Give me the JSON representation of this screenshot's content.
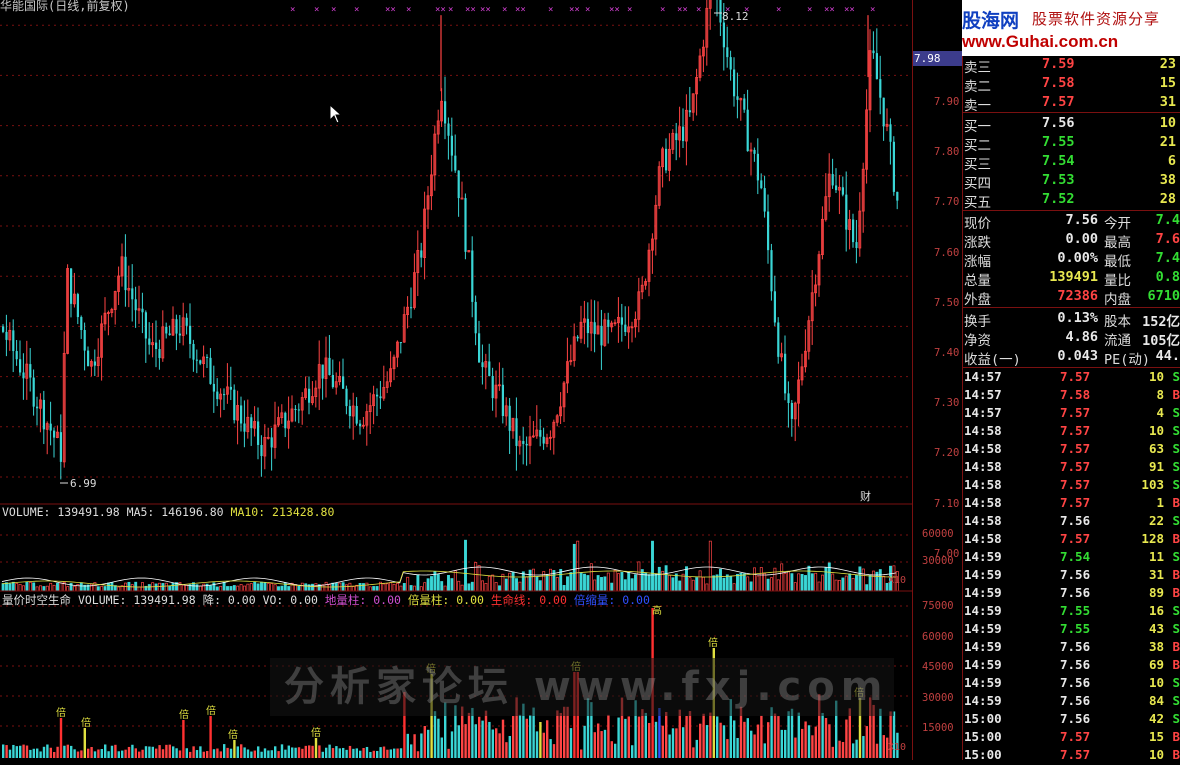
{
  "main": {
    "title": "华能国际(日线,前复权)",
    "high_label": "8.12",
    "low_label": "6.99",
    "current_tag": "7.98",
    "fin_mark": "财",
    "y_axis": [
      "7.90",
      "7.80",
      "7.70",
      "7.60",
      "7.50",
      "7.40",
      "7.30",
      "7.20",
      "7.10",
      "7.00"
    ]
  },
  "volume": {
    "label": "VOLUME: 139491.98",
    "ma5": "MA5: 146196.80",
    "ma10": "MA10: 213428.80",
    "y_axis": [
      "60000",
      "30000"
    ],
    "unit": "X10"
  },
  "indicator": {
    "name": "量价时空生命",
    "volume": "VOLUME: 139491.98",
    "jiang": "降: 0.00",
    "vo": "VO: 0.00",
    "diliang": "地量柱: 0.00",
    "beiliang": "倍量柱: 0.00",
    "shengming": "生命线: 0.00",
    "beisuo": "倍缩量: 0.00",
    "y_axis": [
      "75000",
      "60000",
      "45000",
      "30000",
      "15000"
    ],
    "unit": "X10",
    "bei_mark": "倍",
    "gao_mark": "高"
  },
  "logo": {
    "brand": "股海网",
    "slogan": "股票软件资源分享",
    "url": "www.Guhai.com.cn"
  },
  "order_book": [
    {
      "label": "卖三",
      "price": "7.59",
      "vol": "23",
      "color": "#ff4444"
    },
    {
      "label": "卖二",
      "price": "7.58",
      "vol": "15",
      "color": "#ff4444"
    },
    {
      "label": "卖一",
      "price": "7.57",
      "vol": "31",
      "color": "#ff4444"
    },
    {
      "label": "买一",
      "price": "7.56",
      "vol": "10",
      "color": "#e8e8e8"
    },
    {
      "label": "买二",
      "price": "7.55",
      "vol": "21",
      "color": "#33dd33"
    },
    {
      "label": "买三",
      "price": "7.54",
      "vol": "6",
      "color": "#33dd33"
    },
    {
      "label": "买四",
      "price": "7.53",
      "vol": "38",
      "color": "#33dd33"
    },
    {
      "label": "买五",
      "price": "7.52",
      "vol": "28",
      "color": "#33dd33"
    }
  ],
  "stats": [
    {
      "l1": "现价",
      "v1": "7.56",
      "c1": "#e8e8e8",
      "l2": "今开",
      "v2": "7.4",
      "c2": "#33dd33"
    },
    {
      "l1": "涨跌",
      "v1": "0.00",
      "c1": "#e8e8e8",
      "l2": "最高",
      "v2": "7.6",
      "c2": "#ff4444"
    },
    {
      "l1": "涨幅",
      "v1": "0.00%",
      "c1": "#e8e8e8",
      "l2": "最低",
      "v2": "7.4",
      "c2": "#33dd33"
    },
    {
      "l1": "总量",
      "v1": "139491",
      "c1": "#e8e850",
      "l2": "量比",
      "v2": "0.8",
      "c2": "#33dd33"
    },
    {
      "l1": "外盘",
      "v1": "72386",
      "c1": "#ff4444",
      "l2": "内盘",
      "v2": "6710",
      "c2": "#33dd33"
    }
  ],
  "fundamentals": [
    {
      "l1": "换手",
      "v1": "0.13%",
      "l2": "股本",
      "v2": "152亿"
    },
    {
      "l1": "净资",
      "v1": "4.86",
      "l2": "流通",
      "v2": "105亿"
    },
    {
      "l1": "收益(一)",
      "v1": "0.043",
      "l2": "PE(动)",
      "v2": "44."
    }
  ],
  "ticks": [
    {
      "t": "14:57",
      "p": "7.57",
      "pc": "#ff4444",
      "v": "10",
      "d": "S",
      "dc": "#33dd33"
    },
    {
      "t": "14:57",
      "p": "7.58",
      "pc": "#ff4444",
      "v": "8",
      "d": "B",
      "dc": "#ff4444"
    },
    {
      "t": "14:57",
      "p": "7.57",
      "pc": "#ff4444",
      "v": "4",
      "d": "S",
      "dc": "#33dd33"
    },
    {
      "t": "14:58",
      "p": "7.57",
      "pc": "#ff4444",
      "v": "10",
      "d": "S",
      "dc": "#33dd33"
    },
    {
      "t": "14:58",
      "p": "7.57",
      "pc": "#ff4444",
      "v": "63",
      "d": "S",
      "dc": "#33dd33"
    },
    {
      "t": "14:58",
      "p": "7.57",
      "pc": "#ff4444",
      "v": "91",
      "d": "S",
      "dc": "#33dd33"
    },
    {
      "t": "14:58",
      "p": "7.57",
      "pc": "#ff4444",
      "v": "103",
      "d": "S",
      "dc": "#33dd33"
    },
    {
      "t": "14:58",
      "p": "7.57",
      "pc": "#ff4444",
      "v": "1",
      "d": "B",
      "dc": "#ff4444"
    },
    {
      "t": "14:58",
      "p": "7.56",
      "pc": "#e8e8e8",
      "v": "22",
      "d": "S",
      "dc": "#33dd33"
    },
    {
      "t": "14:58",
      "p": "7.57",
      "pc": "#ff4444",
      "v": "128",
      "d": "B",
      "dc": "#ff4444"
    },
    {
      "t": "14:59",
      "p": "7.54",
      "pc": "#33dd33",
      "v": "11",
      "d": "S",
      "dc": "#33dd33"
    },
    {
      "t": "14:59",
      "p": "7.56",
      "pc": "#e8e8e8",
      "v": "31",
      "d": "B",
      "dc": "#ff4444"
    },
    {
      "t": "14:59",
      "p": "7.56",
      "pc": "#e8e8e8",
      "v": "89",
      "d": "B",
      "dc": "#ff4444"
    },
    {
      "t": "14:59",
      "p": "7.55",
      "pc": "#33dd33",
      "v": "16",
      "d": "S",
      "dc": "#33dd33"
    },
    {
      "t": "14:59",
      "p": "7.55",
      "pc": "#33dd33",
      "v": "43",
      "d": "S",
      "dc": "#33dd33"
    },
    {
      "t": "14:59",
      "p": "7.56",
      "pc": "#e8e8e8",
      "v": "38",
      "d": "B",
      "dc": "#ff4444"
    },
    {
      "t": "14:59",
      "p": "7.56",
      "pc": "#e8e8e8",
      "v": "69",
      "d": "B",
      "dc": "#ff4444"
    },
    {
      "t": "14:59",
      "p": "7.56",
      "pc": "#e8e8e8",
      "v": "10",
      "d": "S",
      "dc": "#33dd33"
    },
    {
      "t": "14:59",
      "p": "7.56",
      "pc": "#e8e8e8",
      "v": "84",
      "d": "S",
      "dc": "#33dd33"
    },
    {
      "t": "15:00",
      "p": "7.56",
      "pc": "#e8e8e8",
      "v": "42",
      "d": "S",
      "dc": "#33dd33"
    },
    {
      "t": "15:00",
      "p": "7.57",
      "pc": "#ff4444",
      "v": "15",
      "d": "B",
      "dc": "#ff4444"
    },
    {
      "t": "15:00",
      "p": "7.57",
      "pc": "#ff4444",
      "v": "10",
      "d": "B",
      "dc": "#ff4444"
    }
  ],
  "watermark": "分析家论坛 www.fxj.com",
  "colors": {
    "up": "#ff4444",
    "down": "#3ad6d6",
    "grid": "#7a1010",
    "ma5": "#ffffff",
    "ma10": "#e0e040"
  }
}
